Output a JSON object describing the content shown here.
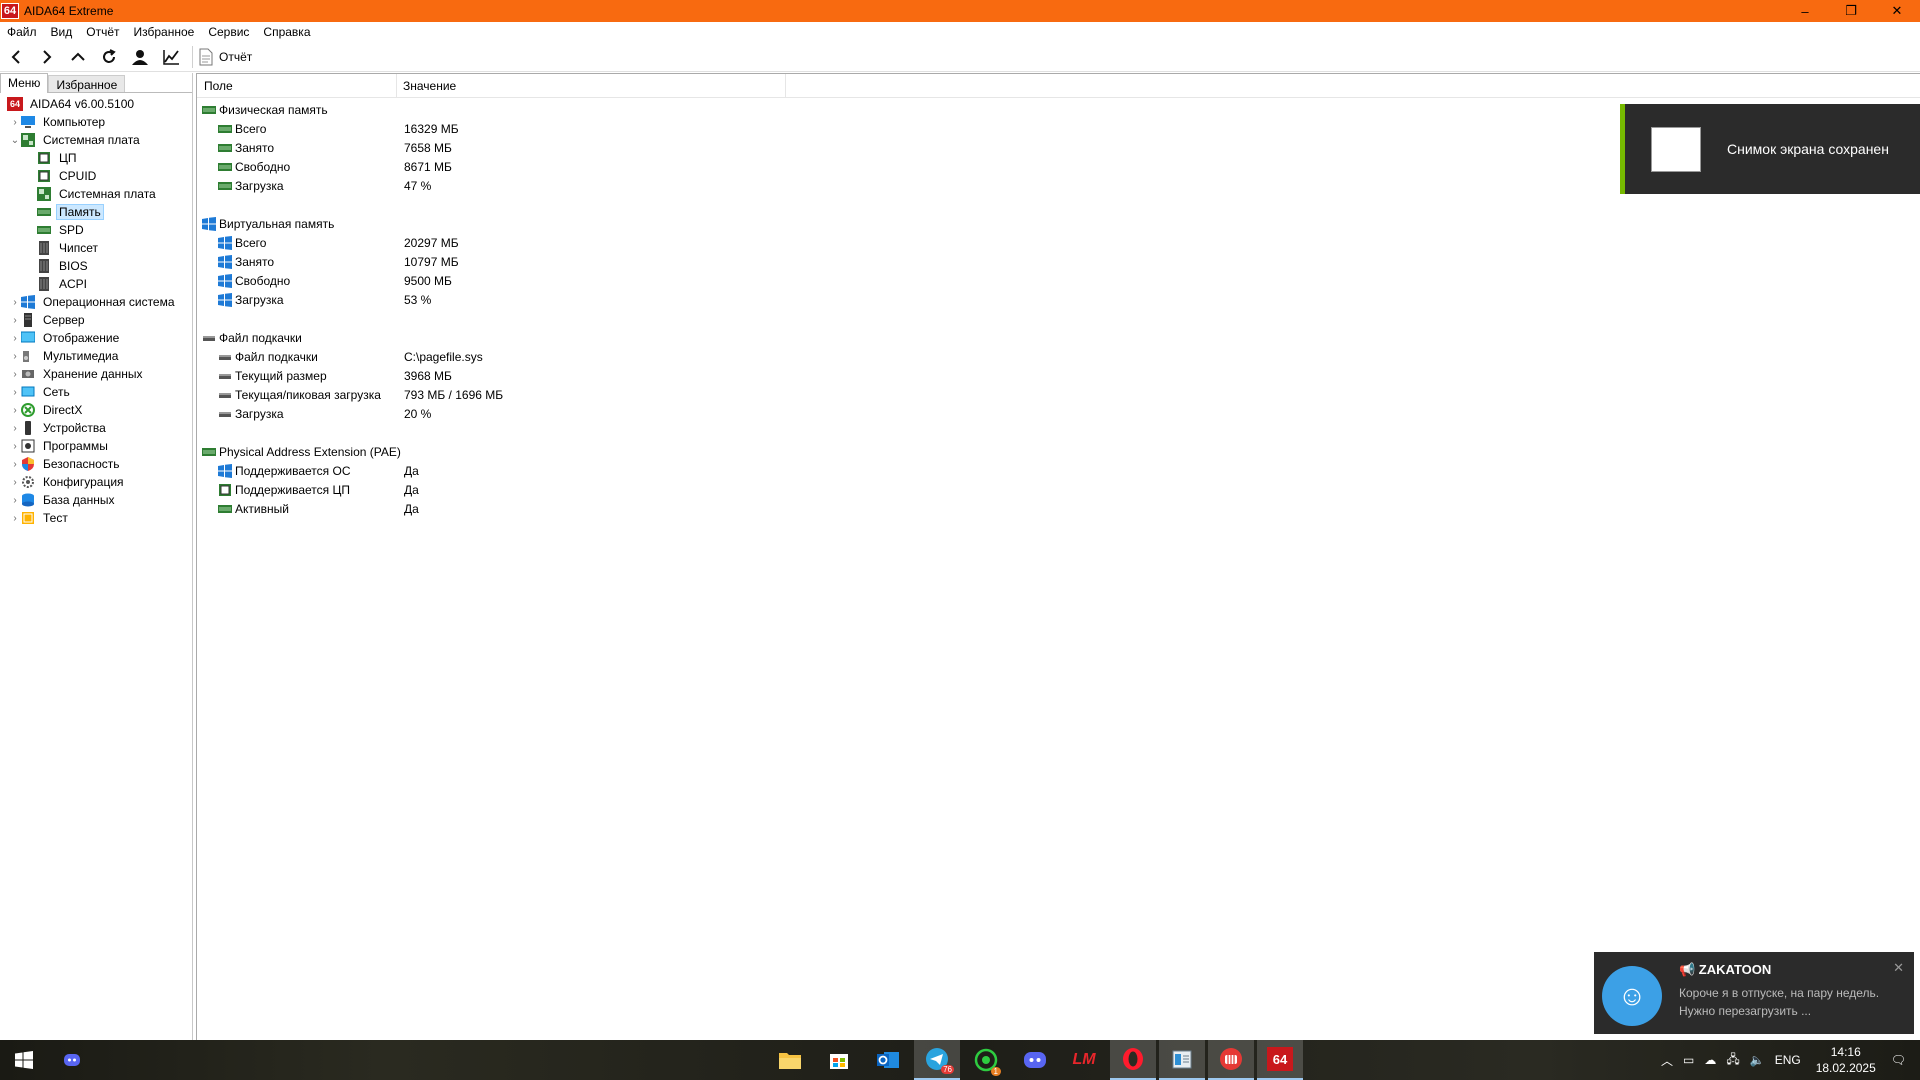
{
  "window": {
    "logo": "64",
    "title": "AIDA64 Extreme",
    "controls": [
      "–",
      "❐",
      "✕"
    ]
  },
  "menu": [
    "Файл",
    "Вид",
    "Отчёт",
    "Избранное",
    "Сервис",
    "Справка"
  ],
  "toolbar": {
    "report_label": "Отчёт"
  },
  "left": {
    "tabs": [
      "Меню",
      "Избранное"
    ],
    "root": "AIDA64 v6.00.5100",
    "tree": [
      {
        "label": "Компьютер",
        "level": 1,
        "expander": "›",
        "icon": "computer"
      },
      {
        "label": "Системная плата",
        "level": 1,
        "expander": "⌄",
        "icon": "motherboard"
      },
      {
        "label": "ЦП",
        "level": 2,
        "expander": "",
        "icon": "cpu"
      },
      {
        "label": "CPUID",
        "level": 2,
        "expander": "",
        "icon": "cpu"
      },
      {
        "label": "Системная плата",
        "level": 2,
        "expander": "",
        "icon": "motherboard"
      },
      {
        "label": "Память",
        "level": 2,
        "expander": "",
        "icon": "memory",
        "selected": true
      },
      {
        "label": "SPD",
        "level": 2,
        "expander": "",
        "icon": "memory"
      },
      {
        "label": "Чипсет",
        "level": 2,
        "expander": "",
        "icon": "chip"
      },
      {
        "label": "BIOS",
        "level": 2,
        "expander": "",
        "icon": "chip"
      },
      {
        "label": "ACPI",
        "level": 2,
        "expander": "",
        "icon": "chip"
      },
      {
        "label": "Операционная система",
        "level": 1,
        "expander": "›",
        "icon": "windows"
      },
      {
        "label": "Сервер",
        "level": 1,
        "expander": "›",
        "icon": "server"
      },
      {
        "label": "Отображение",
        "level": 1,
        "expander": "›",
        "icon": "display"
      },
      {
        "label": "Мультимедиа",
        "level": 1,
        "expander": "›",
        "icon": "multimedia"
      },
      {
        "label": "Хранение данных",
        "level": 1,
        "expander": "›",
        "icon": "storage"
      },
      {
        "label": "Сеть",
        "level": 1,
        "expander": "›",
        "icon": "network"
      },
      {
        "label": "DirectX",
        "level": 1,
        "expander": "›",
        "icon": "directx"
      },
      {
        "label": "Устройства",
        "level": 1,
        "expander": "›",
        "icon": "devices"
      },
      {
        "label": "Программы",
        "level": 1,
        "expander": "›",
        "icon": "programs"
      },
      {
        "label": "Безопасность",
        "level": 1,
        "expander": "›",
        "icon": "security"
      },
      {
        "label": "Конфигурация",
        "level": 1,
        "expander": "›",
        "icon": "config"
      },
      {
        "label": "База данных",
        "level": 1,
        "expander": "›",
        "icon": "database"
      },
      {
        "label": "Тест",
        "level": 1,
        "expander": "›",
        "icon": "test"
      }
    ]
  },
  "right": {
    "headers": [
      "Поле",
      "Значение"
    ],
    "rows": [
      {
        "type": "section",
        "icon": "memory",
        "field": "Физическая память",
        "value": ""
      },
      {
        "type": "item",
        "icon": "memory",
        "field": "Всего",
        "value": "16329 МБ"
      },
      {
        "type": "item",
        "icon": "memory",
        "field": "Занято",
        "value": "7658 МБ"
      },
      {
        "type": "item",
        "icon": "memory",
        "field": "Свободно",
        "value": "8671 МБ"
      },
      {
        "type": "item",
        "icon": "memory",
        "field": "Загрузка",
        "value": "47 %"
      },
      {
        "type": "gap"
      },
      {
        "type": "section",
        "icon": "windows",
        "field": "Виртуальная память",
        "value": ""
      },
      {
        "type": "item",
        "icon": "windows",
        "field": "Всего",
        "value": "20297 МБ"
      },
      {
        "type": "item",
        "icon": "windows",
        "field": "Занято",
        "value": "10797 МБ"
      },
      {
        "type": "item",
        "icon": "windows",
        "field": "Свободно",
        "value": "9500 МБ"
      },
      {
        "type": "item",
        "icon": "windows",
        "field": "Загрузка",
        "value": "53 %"
      },
      {
        "type": "gap"
      },
      {
        "type": "section",
        "icon": "disk",
        "field": "Файл подкачки",
        "value": ""
      },
      {
        "type": "item",
        "icon": "disk",
        "field": "Файл подкачки",
        "value": "C:\\pagefile.sys"
      },
      {
        "type": "item",
        "icon": "disk",
        "field": "Текущий размер",
        "value": "3968 МБ"
      },
      {
        "type": "item",
        "icon": "disk",
        "field": "Текущая/пиковая загрузка",
        "value": "793 МБ / 1696 МБ"
      },
      {
        "type": "item",
        "icon": "disk",
        "field": "Загрузка",
        "value": "20 %"
      },
      {
        "type": "gap"
      },
      {
        "type": "section",
        "icon": "memory",
        "field": "Physical Address Extension (PAE)",
        "value": ""
      },
      {
        "type": "item",
        "icon": "windows",
        "field": "Поддерживается ОС",
        "value": "Да"
      },
      {
        "type": "item",
        "icon": "cpu",
        "field": "Поддерживается ЦП",
        "value": "Да"
      },
      {
        "type": "item",
        "icon": "memory",
        "field": "Активный",
        "value": "Да"
      }
    ]
  },
  "notifications": {
    "screenshot": "Снимок экрана сохранен",
    "chat_from": "📢 ZAKATOON",
    "chat_text": "Короче я в отпуске, на пару недель. Нужно перезагрузить ..."
  },
  "taskbar": {
    "apps": [
      "file-explorer",
      "store",
      "outlook",
      "telegram",
      "whatsapp",
      "discord",
      "lm-studio",
      "opera",
      "notepad",
      "game-launcher",
      "aida64"
    ],
    "telegram_badge": "76",
    "whatsapp_badge": "1",
    "lang": "ENG",
    "time": "14:16",
    "date": "18.02.2025"
  },
  "colors": {
    "titlebar": "#f86a10",
    "selection": "#cce8ff",
    "memory_icon": "#2e7d32",
    "windows_icon": "#1e7ad6"
  }
}
